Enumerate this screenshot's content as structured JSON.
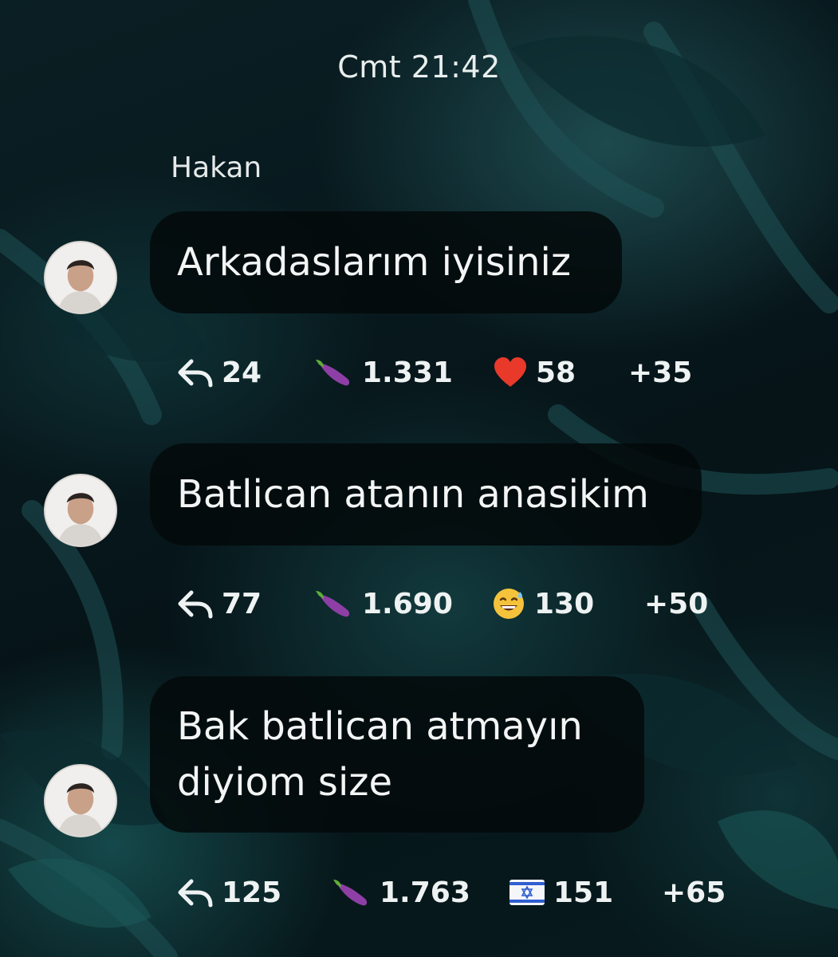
{
  "chat": {
    "timestamp": "Cmt 21:42",
    "sender": "Hakan",
    "messages": [
      {
        "text": "Arkadaslarım iyisiniz",
        "reply_icon": "reply-arrow-icon",
        "reply_count": "24",
        "reactions": [
          {
            "icon": "eggplant-emoji-icon",
            "count": "1.331"
          },
          {
            "icon": "red-heart-emoji-icon",
            "count": "58"
          }
        ],
        "more": "+35"
      },
      {
        "text": "Batlican atanın anasikim",
        "reply_icon": "reply-arrow-icon",
        "reply_count": "77",
        "reactions": [
          {
            "icon": "eggplant-emoji-icon",
            "count": "1.690"
          },
          {
            "icon": "grinning-sweat-emoji-icon",
            "count": "130"
          }
        ],
        "more": "+50"
      },
      {
        "text": "Bak batlican atmayın\ndiyiom size",
        "reply_icon": "reply-arrow-icon",
        "reply_count": "125",
        "reactions": [
          {
            "icon": "eggplant-emoji-icon",
            "count": "1.763"
          },
          {
            "icon": "israel-flag-emoji-icon",
            "count": "151"
          }
        ],
        "more": "+65"
      }
    ]
  },
  "colors": {
    "background": "#07181c",
    "bubble": "#04090b",
    "text": "#f3f5f5",
    "eggplant": "#8e3fa6",
    "heart": "#e8392b",
    "emoji_face": "#f5c33b",
    "flag_blue": "#2f5fd0"
  }
}
